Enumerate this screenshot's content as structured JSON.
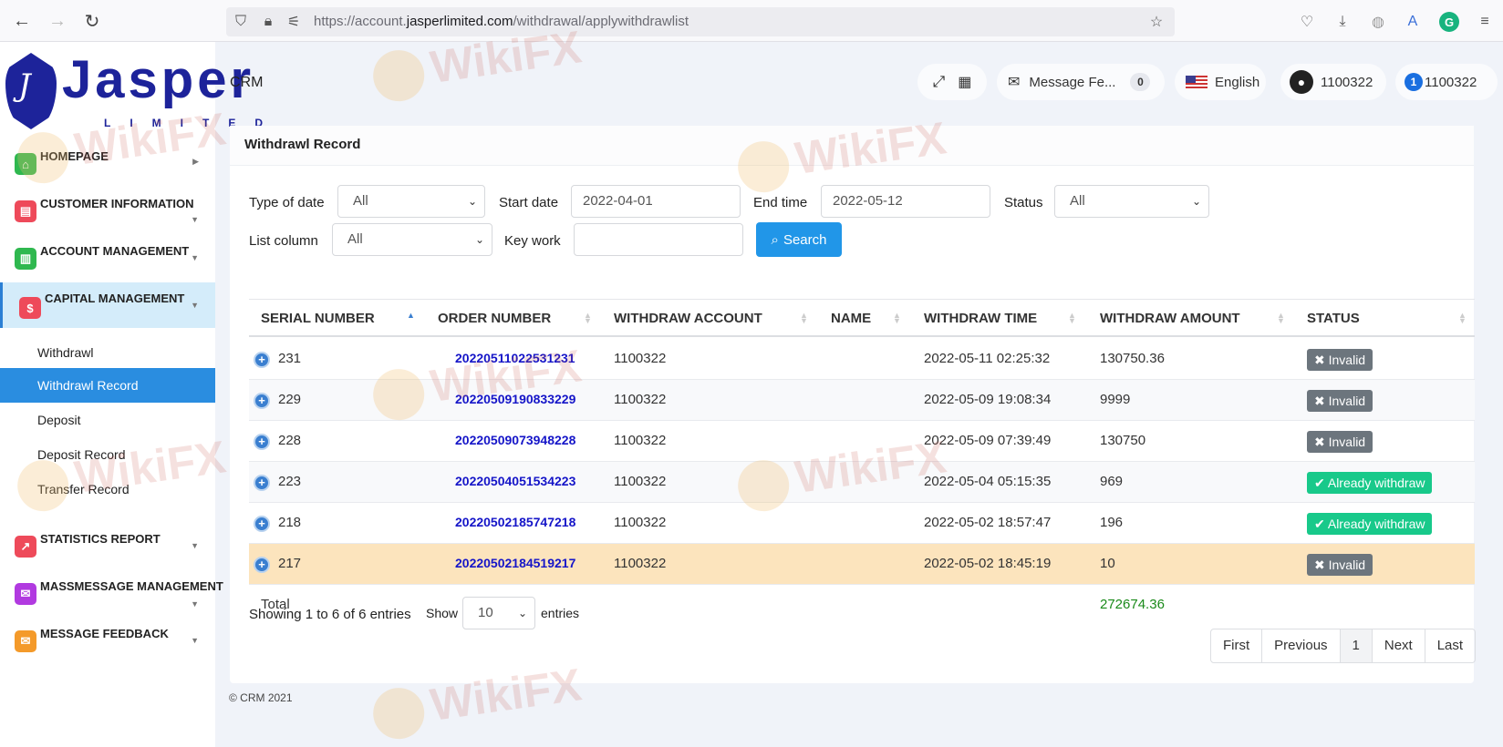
{
  "browser": {
    "url_prefix": "https://account.",
    "url_domain": "jasperlimited.com",
    "url_path": "/withdrawal/applywithdrawlist"
  },
  "logo": {
    "name": "Jasper",
    "sub": "LIMITED",
    "mark": "J"
  },
  "sidebar": {
    "items": [
      {
        "label": "HOMEPAGE",
        "color": "#2fb84f",
        "glyph": "⌂"
      },
      {
        "label": "CUSTOMER INFORMATION",
        "color": "#ee4a5a",
        "glyph": "▤"
      },
      {
        "label": "ACCOUNT MANAGEMENT",
        "color": "#2fb84f",
        "glyph": "▥"
      },
      {
        "label": "CAPITAL MANAGEMENT",
        "color": "#ee4a5a",
        "glyph": "$"
      },
      {
        "label": "STATISTICS REPORT",
        "color": "#ee4a5a",
        "glyph": "↗"
      },
      {
        "label": "MASSMESSAGE MANAGEMENT",
        "color": "#b13ae0",
        "glyph": "✉"
      },
      {
        "label": "MESSAGE FEEDBACK",
        "color": "#f49a2a",
        "glyph": "✉"
      }
    ],
    "submenu": [
      "Withdrawl",
      "Withdrawl Record",
      "Deposit",
      "Deposit Record",
      "Transfer Record"
    ]
  },
  "header": {
    "title": "CRM",
    "message_label": "Message Fe...",
    "message_count": "0",
    "language": "English",
    "user": "1100322",
    "account_badge": "1",
    "account": "1100322"
  },
  "card": {
    "title": "Withdrawl Record"
  },
  "filters": {
    "type_of_date_label": "Type of date",
    "type_of_date_value": "All",
    "start_date_label": "Start date",
    "start_date_value": "2022-04-01",
    "end_time_label": "End time",
    "end_time_value": "2022-05-12",
    "status_label": "Status",
    "status_value": "All",
    "list_column_label": "List column",
    "list_column_value": "All",
    "key_work_label": "Key work",
    "key_work_value": "",
    "search_label": "Search"
  },
  "table": {
    "columns": [
      "SERIAL NUMBER",
      "ORDER NUMBER",
      "WITHDRAW ACCOUNT",
      "NAME",
      "WITHDRAW TIME",
      "WITHDRAW AMOUNT",
      "STATUS"
    ],
    "rows": [
      {
        "serial": "231",
        "order": "20220511022531231",
        "account": "1100322",
        "name": "",
        "time": "2022-05-11 02:25:32",
        "amount": "130750.36",
        "status": "Invalid"
      },
      {
        "serial": "229",
        "order": "20220509190833229",
        "account": "1100322",
        "name": "",
        "time": "2022-05-09 19:08:34",
        "amount": "9999",
        "status": "Invalid"
      },
      {
        "serial": "228",
        "order": "20220509073948228",
        "account": "1100322",
        "name": "",
        "time": "2022-05-09 07:39:49",
        "amount": "130750",
        "status": "Invalid"
      },
      {
        "serial": "223",
        "order": "20220504051534223",
        "account": "1100322",
        "name": "",
        "time": "2022-05-04 05:15:35",
        "amount": "969",
        "status": "Already withdraw"
      },
      {
        "serial": "218",
        "order": "20220502185747218",
        "account": "1100322",
        "name": "",
        "time": "2022-05-02 18:57:47",
        "amount": "196",
        "status": "Already withdraw"
      },
      {
        "serial": "217",
        "order": "20220502184519217",
        "account": "1100322",
        "name": "",
        "time": "2022-05-02 18:45:19",
        "amount": "10",
        "status": "Invalid"
      }
    ],
    "total_label": "Total",
    "total_value": "272674.36"
  },
  "pagination": {
    "info": "Showing 1 to 6 of 6 entries",
    "show_label": "Show",
    "page_size": "10",
    "entries_label": "entries",
    "first": "First",
    "previous": "Previous",
    "current": "1",
    "next": "Next",
    "last": "Last"
  },
  "footer": {
    "text": "© CRM 2021"
  },
  "watermark": "WikiFX"
}
